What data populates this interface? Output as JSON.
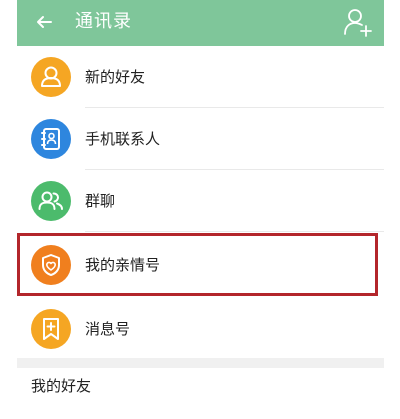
{
  "header": {
    "title": "通讯录",
    "back_icon": "back-arrow-icon",
    "add_icon": "add-friend-icon",
    "background": "#7fc69a"
  },
  "menu": {
    "items": [
      {
        "label": "新的好友",
        "icon": "user-icon",
        "color": "#f5a623"
      },
      {
        "label": "手机联系人",
        "icon": "contacts-book-icon",
        "color": "#2e86de"
      },
      {
        "label": "群聊",
        "icon": "group-icon",
        "color": "#4cbb6c"
      },
      {
        "label": "我的亲情号",
        "icon": "shield-heart-icon",
        "color": "#f07f1e",
        "highlighted": true
      },
      {
        "label": "消息号",
        "icon": "bookmark-plus-icon",
        "color": "#f5a623"
      }
    ]
  },
  "section": {
    "title": "我的好友"
  },
  "colors": {
    "highlight_border": "#b3262b"
  }
}
